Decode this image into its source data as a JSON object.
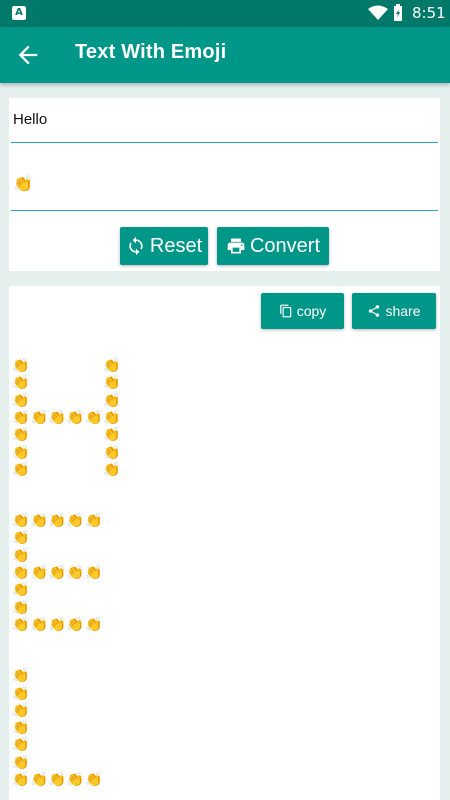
{
  "status_bar": {
    "time": "8:51",
    "notification": "A"
  },
  "app_bar": {
    "title": "Text With Emoji"
  },
  "input": {
    "text": "Hello",
    "emoji": "👏"
  },
  "buttons": {
    "reset": "Reset",
    "convert": "Convert",
    "copy": "copy",
    "share": "share"
  },
  "output": {
    "emoji": "👏",
    "source_text": "Hel"
  },
  "colors": {
    "primary": "#009688",
    "primary_dark": "#00796b",
    "accent_line": "#29a6c6",
    "background": "#e5f0ee"
  }
}
